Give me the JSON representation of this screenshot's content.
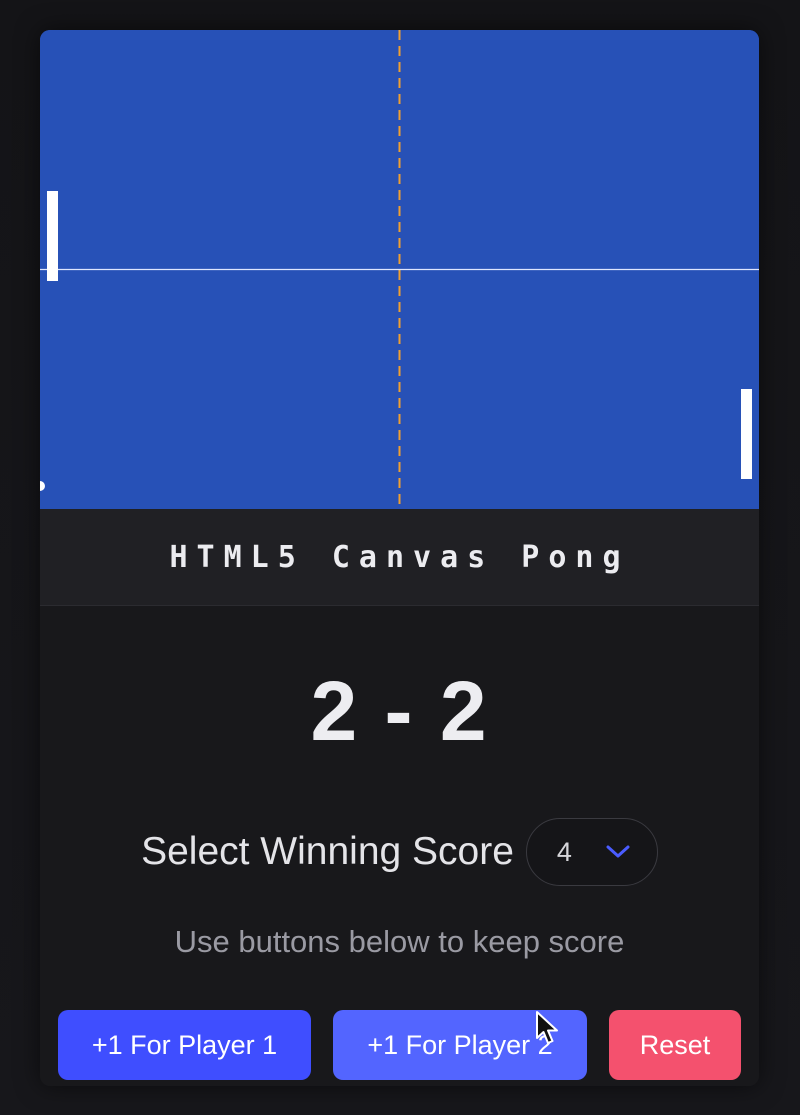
{
  "game": {
    "title": "HTML5 Canvas Pong",
    "score_display": "2 - 2",
    "player1_score": 2,
    "player2_score": 2
  },
  "settings": {
    "winning_score_label": "Select Winning Score",
    "winning_score_value": "4"
  },
  "hint": "Use buttons below to keep score",
  "buttons": {
    "player1": "+1 For Player 1",
    "player2": "+1 For Player 2",
    "reset": "Reset"
  },
  "colors": {
    "field": "#2751b7",
    "center_line": "#f0a030",
    "player1_button": "#3f4eff",
    "player2_button": "#5365ff",
    "reset_button": "#f4516e",
    "select_chevron": "#4a5cff"
  },
  "icons": {
    "select_arrow": "chevron-down-icon",
    "pointer": "mouse-cursor-icon"
  }
}
